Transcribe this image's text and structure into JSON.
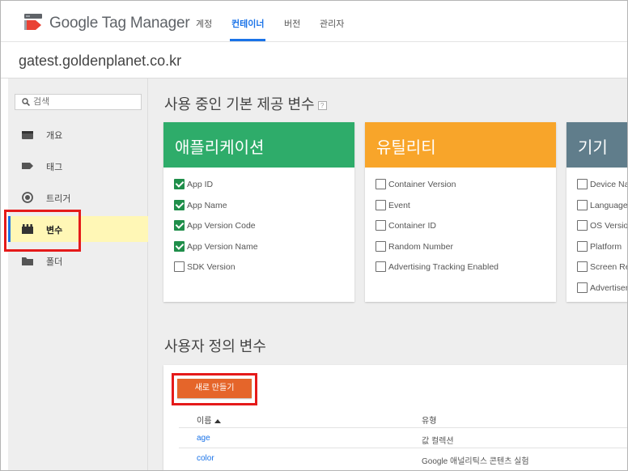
{
  "app": {
    "brand": "Google Tag Manager",
    "icon": "tag-manager-logo"
  },
  "topnav": {
    "tabs": [
      {
        "label": "계정",
        "active": false
      },
      {
        "label": "컨테이너",
        "active": true
      },
      {
        "label": "버전",
        "active": false
      },
      {
        "label": "관리자",
        "active": false
      }
    ]
  },
  "container": {
    "domain": "gatest.goldenplanet.co.kr"
  },
  "sidebar": {
    "search": {
      "placeholder": "검색",
      "value": ""
    },
    "items": [
      {
        "label": "개요",
        "icon": "briefcase-icon",
        "active": false
      },
      {
        "label": "태그",
        "icon": "tag-icon",
        "active": false
      },
      {
        "label": "트리거",
        "icon": "trigger-icon",
        "active": false
      },
      {
        "label": "변수",
        "icon": "variables-icon",
        "active": true
      },
      {
        "label": "폴더",
        "icon": "folder-icon",
        "active": false
      }
    ]
  },
  "builtin": {
    "title": "사용 중인 기본 제공 변수",
    "help": "?",
    "cards": [
      {
        "title": "애플리케이션",
        "color": "#2eac6a",
        "items": [
          {
            "label": "App ID",
            "checked": true
          },
          {
            "label": "App Name",
            "checked": true
          },
          {
            "label": "App Version Code",
            "checked": true
          },
          {
            "label": "App Version Name",
            "checked": true
          },
          {
            "label": "SDK Version",
            "checked": false
          }
        ]
      },
      {
        "title": "유틸리티",
        "color": "#f8a52a",
        "items": [
          {
            "label": "Container Version",
            "checked": false
          },
          {
            "label": "Event",
            "checked": false
          },
          {
            "label": "Container ID",
            "checked": false
          },
          {
            "label": "Random Number",
            "checked": false
          },
          {
            "label": "Advertising Tracking Enabled",
            "checked": false
          }
        ]
      },
      {
        "title": "기기",
        "color": "#607d8b",
        "items": [
          {
            "label": "Device Na",
            "checked": false
          },
          {
            "label": "Language",
            "checked": false
          },
          {
            "label": "OS Versio",
            "checked": false
          },
          {
            "label": "Platform",
            "checked": false
          },
          {
            "label": "Screen Re",
            "checked": false
          },
          {
            "label": "Advertiser",
            "checked": false
          }
        ]
      }
    ]
  },
  "user_defined": {
    "title": "사용자 정의 변수",
    "new_button": "새로 만들기",
    "columns": {
      "name": "이름",
      "type": "유형"
    },
    "rows": [
      {
        "name": "age",
        "type": "값 컬렉션"
      },
      {
        "name": "color",
        "type": "Google 애널리틱스 콘텐츠 실험"
      }
    ]
  },
  "colors": {
    "accent": "#1a73e8",
    "highlight_box": "#e51a1a",
    "new_button": "#e5652a"
  }
}
